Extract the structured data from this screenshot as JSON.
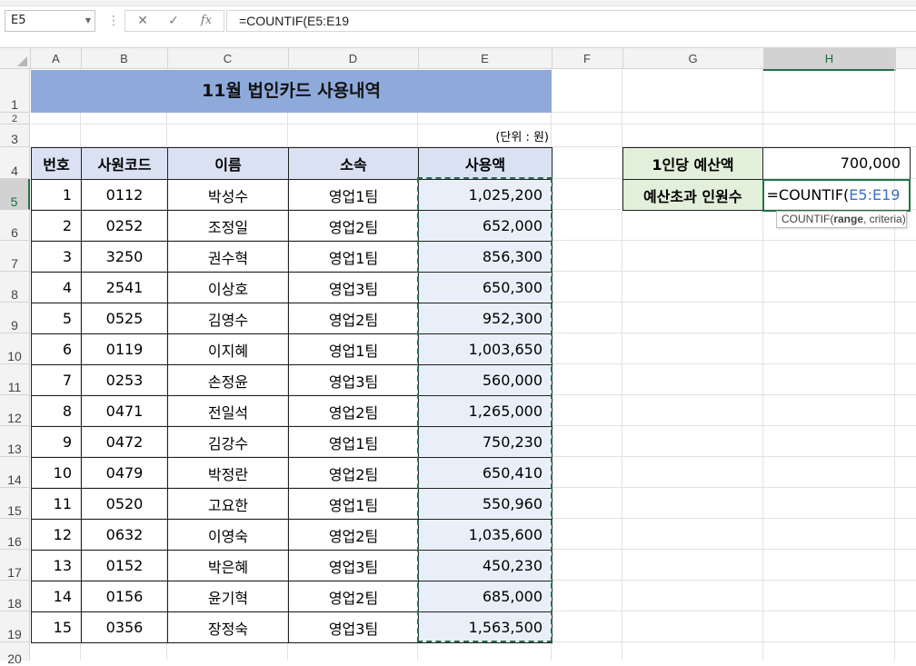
{
  "name_box": "E5",
  "formula_bar": {
    "cancel_icon": "✕",
    "enter_icon": "✓",
    "fx_label": "fx",
    "formula": "=COUNTIF(E5:E19"
  },
  "columns": [
    "A",
    "B",
    "C",
    "D",
    "E",
    "F",
    "G",
    "H"
  ],
  "rows": [
    "1",
    "2",
    "3",
    "4",
    "5",
    "6",
    "7",
    "8",
    "9",
    "10",
    "11",
    "12",
    "13",
    "14",
    "15",
    "16",
    "17",
    "18",
    "19",
    "20"
  ],
  "title": "11월 법인카드 사용내역",
  "unit": "(단위 : 원)",
  "table": {
    "headers": [
      "번호",
      "사원코드",
      "이름",
      "소속",
      "사용액"
    ],
    "rows": [
      [
        "1",
        "0112",
        "박성수",
        "영업1팀",
        "1,025,200"
      ],
      [
        "2",
        "0252",
        "조정일",
        "영업2팀",
        "652,000"
      ],
      [
        "3",
        "3250",
        "권수혁",
        "영업1팀",
        "856,300"
      ],
      [
        "4",
        "2541",
        "이상호",
        "영업3팀",
        "650,300"
      ],
      [
        "5",
        "0525",
        "김영수",
        "영업2팀",
        "952,300"
      ],
      [
        "6",
        "0119",
        "이지혜",
        "영업1팀",
        "1,003,650"
      ],
      [
        "7",
        "0253",
        "손정윤",
        "영업3팀",
        "560,000"
      ],
      [
        "8",
        "0471",
        "전일석",
        "영업2팀",
        "1,265,000"
      ],
      [
        "9",
        "0472",
        "김강수",
        "영업1팀",
        "750,230"
      ],
      [
        "10",
        "0479",
        "박정란",
        "영업2팀",
        "650,410"
      ],
      [
        "11",
        "0520",
        "고요한",
        "영업1팀",
        "550,960"
      ],
      [
        "12",
        "0632",
        "이영숙",
        "영업2팀",
        "1,035,600"
      ],
      [
        "13",
        "0152",
        "박은혜",
        "영업3팀",
        "450,230"
      ],
      [
        "14",
        "0156",
        "윤기혁",
        "영업2팀",
        "685,000"
      ],
      [
        "15",
        "0356",
        "장정숙",
        "영업3팀",
        "1,563,500"
      ]
    ]
  },
  "side": {
    "budget_label": "1인당 예산액",
    "budget_value": "700,000",
    "over_label": "예산초과 인원수",
    "formula_prefix": "=COUNTIF(",
    "formula_ref": "E5:E19"
  },
  "tooltip": {
    "fn": "COUNTIF(",
    "arg1": "range",
    "rest": ", criteria)"
  },
  "colors": {
    "title_fill": "#8eaadb",
    "header_fill": "#d9e1f2",
    "side_label_fill": "#e2efda",
    "selection": "#217346",
    "reference_blue": "#3b6fc4"
  }
}
